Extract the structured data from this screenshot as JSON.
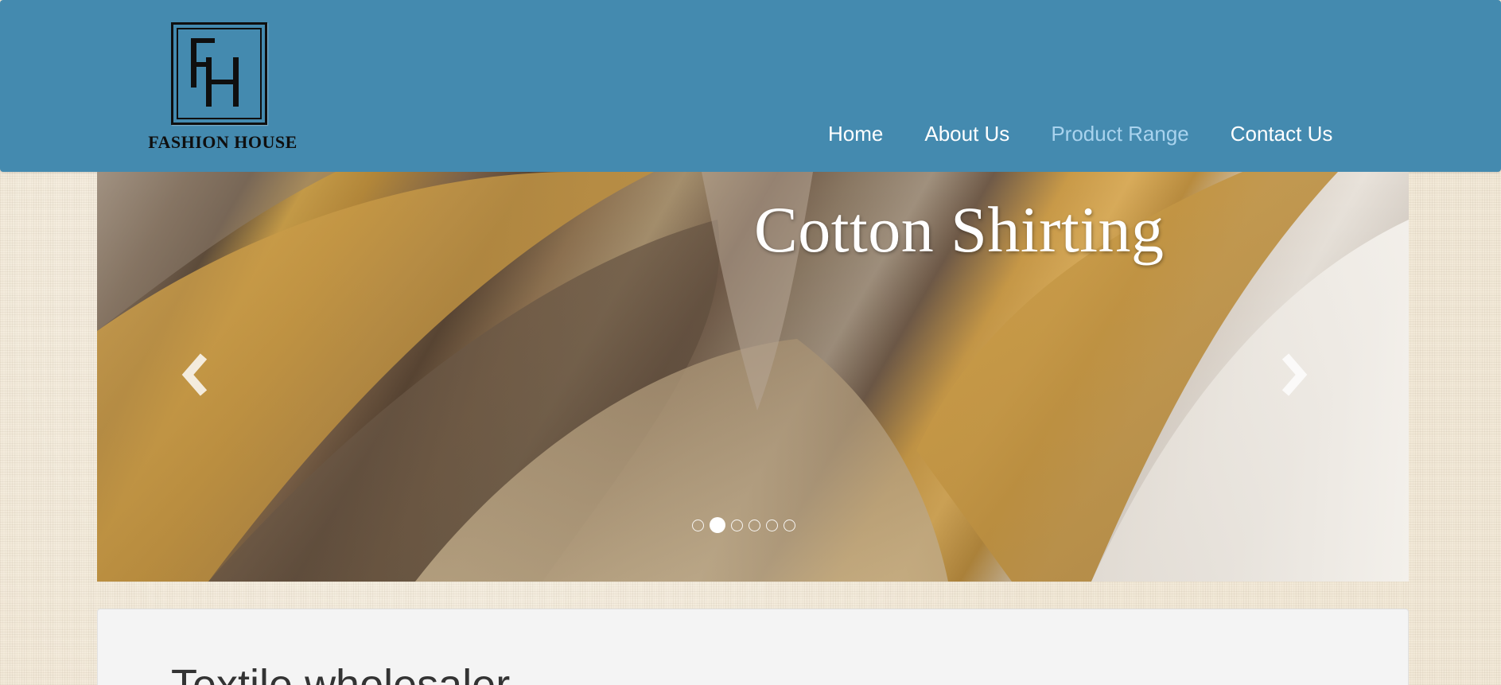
{
  "brand": {
    "logo_monogram": "FH",
    "logo_text": "FASHION HOUSE"
  },
  "nav": {
    "items": [
      {
        "label": "Home",
        "active": false
      },
      {
        "label": "About Us",
        "active": false
      },
      {
        "label": "Product Range",
        "active": true
      },
      {
        "label": "Contact Us",
        "active": false
      }
    ]
  },
  "carousel": {
    "caption": "Cotton Shirting",
    "prev_icon": "chevron-left-icon",
    "next_icon": "chevron-right-icon",
    "slide_count": 6,
    "active_slide": 2
  },
  "main": {
    "heading": "Textile wholesaler"
  },
  "colors": {
    "header_bg": "#448aaf",
    "nav_text": "#ffffff",
    "nav_active": "#a9d3ee",
    "panel_bg": "#f4f4f4",
    "heading_text": "#333333"
  }
}
